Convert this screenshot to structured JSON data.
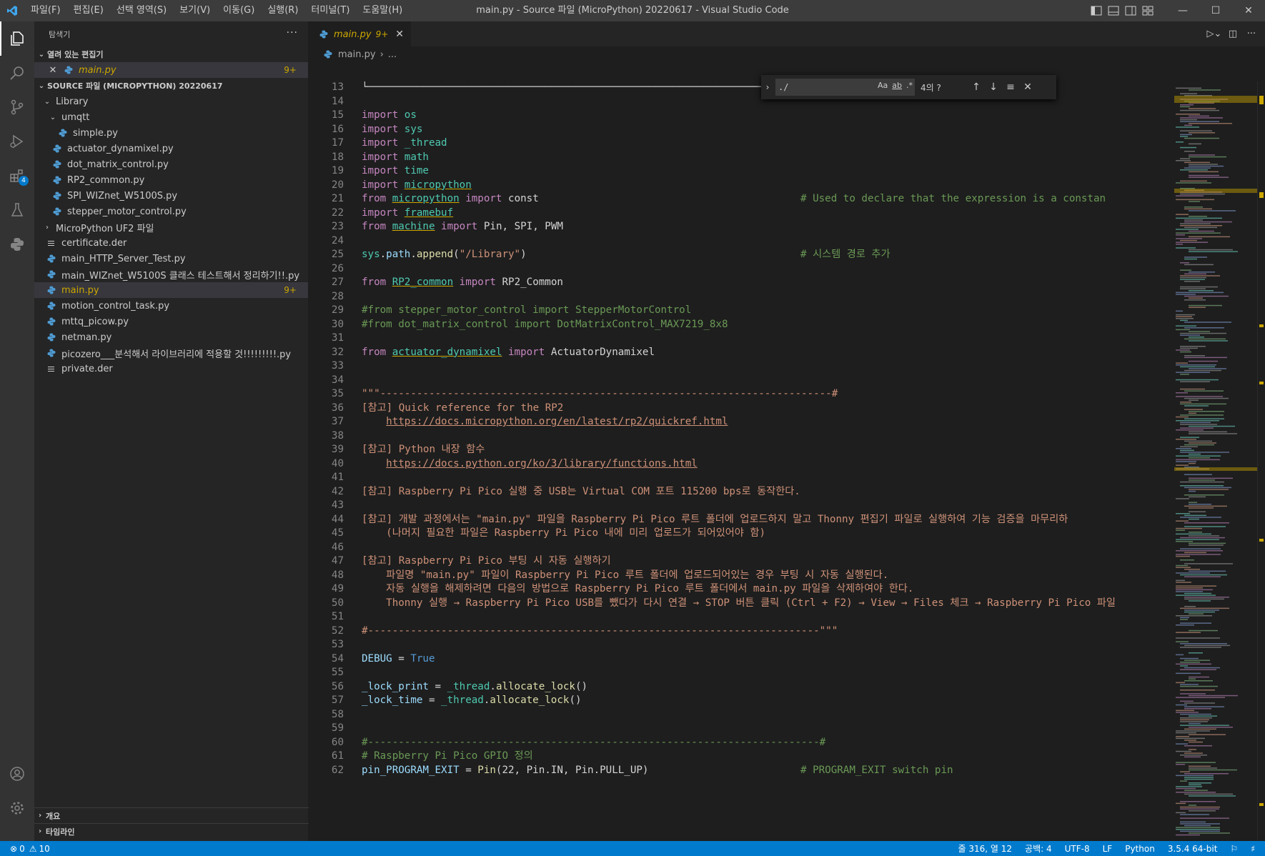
{
  "window": {
    "title": "main.py - Source 파일 (MicroPython) 20220617 - Visual Studio Code",
    "menus": [
      "파일(F)",
      "편집(E)",
      "선택 영역(S)",
      "보기(V)",
      "이동(G)",
      "실행(R)",
      "터미널(T)",
      "도움말(H)"
    ]
  },
  "activity_bar": {
    "extensions_badge": "4"
  },
  "sidebar": {
    "title": "탐색기",
    "open_editors": {
      "header": "열려 있는 편집기",
      "items": [
        {
          "name": "main.py",
          "suffix": "9+"
        }
      ]
    },
    "folder": {
      "header": "SOURCE 파일 (MICROPYTHON) 20220617",
      "items": [
        {
          "name": "Library",
          "kind": "folder",
          "depth": 1,
          "open": true
        },
        {
          "name": "umqtt",
          "kind": "folder",
          "depth": 2,
          "open": true
        },
        {
          "name": "simple.py",
          "kind": "py",
          "depth": 3
        },
        {
          "name": "actuator_dynamixel.py",
          "kind": "py",
          "depth": 2
        },
        {
          "name": "dot_matrix_control.py",
          "kind": "py",
          "depth": 2
        },
        {
          "name": "RP2_common.py",
          "kind": "py",
          "depth": 2
        },
        {
          "name": "SPI_WIZnet_W5100S.py",
          "kind": "py",
          "depth": 2
        },
        {
          "name": "stepper_motor_control.py",
          "kind": "py",
          "depth": 2
        },
        {
          "name": "MicroPython UF2 파일",
          "kind": "folder",
          "depth": 1,
          "open": false
        },
        {
          "name": "certificate.der",
          "kind": "file",
          "depth": 1
        },
        {
          "name": "main_HTTP_Server_Test.py",
          "kind": "py",
          "depth": 1
        },
        {
          "name": "main_WIZnet_W5100S 클래스 테스트해서 정리하기!!.py",
          "kind": "py",
          "depth": 1
        },
        {
          "name": "main.py",
          "kind": "py",
          "depth": 1,
          "selected": true,
          "suffix": "9+"
        },
        {
          "name": "motion_control_task.py",
          "kind": "py",
          "depth": 1
        },
        {
          "name": "mttq_picow.py",
          "kind": "py",
          "depth": 1
        },
        {
          "name": "netman.py",
          "kind": "py",
          "depth": 1
        },
        {
          "name": "picozero___분석해서 라이브러리에 적용할 것!!!!!!!!!.py",
          "kind": "py",
          "depth": 1
        },
        {
          "name": "private.der",
          "kind": "file",
          "depth": 1
        }
      ]
    },
    "outline_label": "개요",
    "timeline_label": "타임라인"
  },
  "editor": {
    "tab": {
      "name": "main.py",
      "count": "9+"
    },
    "breadcrumb": [
      "main.py",
      "..."
    ],
    "find": {
      "query": "./",
      "count": "4의 ?",
      "opt_case": "Aa",
      "opt_word": "ab",
      "opt_regex": ".*"
    },
    "lines": [
      {
        "n": "13",
        "segs": [
          [
            "plain",
            "└──────────────────────────────────────────────────────────────────────"
          ],
          [
            "str",
            "\"\"\""
          ]
        ]
      },
      {
        "n": "14",
        "segs": []
      },
      {
        "n": "15",
        "segs": [
          [
            "kw",
            "import "
          ],
          [
            "mod-n",
            "os"
          ]
        ]
      },
      {
        "n": "16",
        "segs": [
          [
            "kw",
            "import "
          ],
          [
            "mod-n",
            "sys"
          ]
        ]
      },
      {
        "n": "17",
        "segs": [
          [
            "kw",
            "import "
          ],
          [
            "mod-n",
            "_thread"
          ]
        ]
      },
      {
        "n": "18",
        "segs": [
          [
            "kw",
            "import "
          ],
          [
            "mod-n",
            "math"
          ]
        ]
      },
      {
        "n": "19",
        "segs": [
          [
            "kw",
            "import "
          ],
          [
            "mod-n",
            "time"
          ]
        ]
      },
      {
        "n": "20",
        "segs": [
          [
            "kw",
            "import "
          ],
          [
            "mod-n under",
            "micropython"
          ]
        ]
      },
      {
        "n": "21",
        "segs": [
          [
            "kw",
            "from "
          ],
          [
            "mod-n under",
            "micropython"
          ],
          [
            "kw",
            " import "
          ],
          [
            "plain",
            "const"
          ]
        ],
        "cmt": "# Used to declare that the expression is a constan"
      },
      {
        "n": "22",
        "segs": [
          [
            "kw",
            "import "
          ],
          [
            "mod-n under",
            "framebuf"
          ]
        ]
      },
      {
        "n": "23",
        "segs": [
          [
            "kw",
            "from "
          ],
          [
            "mod-n under",
            "machine"
          ],
          [
            "kw",
            " import "
          ],
          [
            "plain",
            "Pin, SPI, PWM"
          ]
        ]
      },
      {
        "n": "24",
        "segs": []
      },
      {
        "n": "25",
        "segs": [
          [
            "mod-n",
            "sys"
          ],
          [
            "plain",
            "."
          ],
          [
            "var",
            "path"
          ],
          [
            "plain",
            "."
          ],
          [
            "fn",
            "append"
          ],
          [
            "plain",
            "("
          ],
          [
            "str",
            "\"/Library\""
          ],
          [
            "plain",
            ")"
          ]
        ],
        "cmt": "# 시스템 경로 추가"
      },
      {
        "n": "26",
        "segs": []
      },
      {
        "n": "27",
        "segs": [
          [
            "kw",
            "from "
          ],
          [
            "mod-n under",
            "RP2_common"
          ],
          [
            "kw",
            " import "
          ],
          [
            "plain",
            "RP2_Common"
          ]
        ]
      },
      {
        "n": "28",
        "segs": []
      },
      {
        "n": "29",
        "segs": [
          [
            "cmt",
            "#from stepper_motor_control import StepperMotorControl"
          ]
        ]
      },
      {
        "n": "30",
        "segs": [
          [
            "cmt",
            "#from dot_matrix_control import DotMatrixControl_MAX7219_8x8"
          ]
        ]
      },
      {
        "n": "31",
        "segs": []
      },
      {
        "n": "32",
        "segs": [
          [
            "kw",
            "from "
          ],
          [
            "mod-n under",
            "actuator_dynamixel"
          ],
          [
            "kw",
            " import "
          ],
          [
            "plain",
            "ActuatorDynamixel"
          ]
        ]
      },
      {
        "n": "33",
        "segs": []
      },
      {
        "n": "34",
        "segs": []
      },
      {
        "n": "35",
        "segs": [
          [
            "str",
            "\"\"\"--------------------------------------------------------------------------#"
          ]
        ]
      },
      {
        "n": "36",
        "segs": [
          [
            "str",
            "[참고] Quick reference for the RP2"
          ]
        ]
      },
      {
        "n": "37",
        "segs": [
          [
            "str",
            "    "
          ],
          [
            "str link",
            "https://docs.micropython.org/en/latest/rp2/quickref.html"
          ]
        ]
      },
      {
        "n": "38",
        "segs": []
      },
      {
        "n": "39",
        "segs": [
          [
            "str",
            "[참고] Python 내장 함수"
          ]
        ]
      },
      {
        "n": "40",
        "segs": [
          [
            "str",
            "    "
          ],
          [
            "str link",
            "https://docs.python.org/ko/3/library/functions.html"
          ]
        ]
      },
      {
        "n": "41",
        "segs": []
      },
      {
        "n": "42",
        "segs": [
          [
            "str",
            "[참고] Raspberry Pi Pico 실행 중 USB는 Virtual COM 포트 115200 bps로 동작한다."
          ]
        ]
      },
      {
        "n": "43",
        "segs": []
      },
      {
        "n": "44",
        "segs": [
          [
            "str",
            "[참고] 개발 과정에서는 \"main.py\" 파일을 Raspberry Pi Pico 루트 폴더에 업로드하지 말고 Thonny 편집기 파일로 실행하여 기능 검증을 마무리하"
          ]
        ]
      },
      {
        "n": "45",
        "segs": [
          [
            "str",
            "    (나머지 필요한 파일은 Raspberry Pi Pico 내에 미리 업로드가 되어있어야 함)"
          ]
        ]
      },
      {
        "n": "46",
        "segs": []
      },
      {
        "n": "47",
        "segs": [
          [
            "str",
            "[참고] Raspberry Pi Pico 부팅 시 자동 실행하기"
          ]
        ]
      },
      {
        "n": "48",
        "segs": [
          [
            "str",
            "    파일명 \"main.py\" 파일이 Raspberry Pi Pico 루트 폴더에 업로드되어있는 경우 부팅 시 자동 실행된다."
          ]
        ]
      },
      {
        "n": "49",
        "segs": [
          [
            "str",
            "    자동 실행을 해제하려면 다음의 방법으로 Raspberry Pi Pico 루트 폴더에서 main.py 파일을 삭제하여야 한다."
          ]
        ]
      },
      {
        "n": "50",
        "segs": [
          [
            "str",
            "    Thonny 실행 → Raspberry Pi Pico USB를 뺐다가 다시 연결 → STOP 버튼 클릭 (Ctrl + F2) → View → Files 체크 → Raspberry Pi Pico 파일"
          ]
        ]
      },
      {
        "n": "51",
        "segs": []
      },
      {
        "n": "52",
        "segs": [
          [
            "str",
            "#--------------------------------------------------------------------------\"\"\""
          ]
        ]
      },
      {
        "n": "53",
        "segs": []
      },
      {
        "n": "54",
        "segs": [
          [
            "var",
            "DEBUG"
          ],
          [
            "plain",
            " = "
          ],
          [
            "const",
            "True"
          ]
        ]
      },
      {
        "n": "55",
        "segs": []
      },
      {
        "n": "56",
        "segs": [
          [
            "var",
            "_lock_print"
          ],
          [
            "plain",
            " = "
          ],
          [
            "mod-n",
            "_thread"
          ],
          [
            "plain",
            "."
          ],
          [
            "fn",
            "allocate_lock"
          ],
          [
            "plain",
            "()"
          ]
        ]
      },
      {
        "n": "57",
        "segs": [
          [
            "var",
            "_lock_time"
          ],
          [
            "plain",
            " = "
          ],
          [
            "mod-n",
            "_thread"
          ],
          [
            "plain",
            "."
          ],
          [
            "fn",
            "allocate_lock"
          ],
          [
            "plain",
            "()"
          ]
        ]
      },
      {
        "n": "58",
        "segs": []
      },
      {
        "n": "59",
        "segs": []
      },
      {
        "n": "60",
        "segs": [
          [
            "cmt",
            "#--------------------------------------------------------------------------#"
          ]
        ]
      },
      {
        "n": "61",
        "segs": [
          [
            "cmt",
            "# Raspberry Pi Pico GPIO 정의"
          ]
        ]
      },
      {
        "n": "62",
        "segs": [
          [
            "var",
            "pin_PROGRAM_EXIT"
          ],
          [
            "plain",
            " = "
          ],
          [
            "fn",
            "Pin"
          ],
          [
            "plain",
            "(22, Pin.IN, Pin.PULL_UP)"
          ]
        ],
        "cmt": "# PROGRAM_EXIT switch pin"
      }
    ]
  },
  "status": {
    "errors": "0",
    "warnings": "10",
    "position": "줄 316, 열 12",
    "indent": "공백: 4",
    "encoding": "UTF-8",
    "eol": "LF",
    "language": "Python",
    "interpreter": "3.5.4 64-bit"
  },
  "colors": {
    "accent": "#007acc",
    "modified": "#cca700",
    "keyword": "#c586c0",
    "module": "#4ec9b0",
    "comment": "#6a9955",
    "string": "#ce9178"
  }
}
